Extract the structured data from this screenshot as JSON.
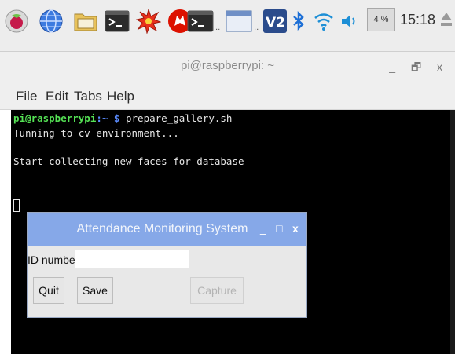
{
  "taskbar": {
    "icons": [
      "raspberry-menu-icon",
      "web-browser-icon",
      "file-manager-icon",
      "terminal-icon",
      "burst-icon",
      "wolfram-icon",
      "terminal-window-icon",
      "window-icon",
      "vnc-icon",
      "bluetooth-icon",
      "wifi-icon",
      "volume-icon"
    ],
    "cpu_usage": "4 %",
    "clock": "15:18"
  },
  "terminal_window": {
    "title": "pi@raspberrypi: ~",
    "controls": [
      "_",
      "🗗",
      "x"
    ],
    "menu": [
      "File",
      "Edit",
      "Tabs",
      "Help"
    ],
    "lines": {
      "prompt_user": "pi@raspberrypi",
      "prompt_path": ":~ $",
      "command": " prepare_gallery.sh",
      "line2": "Tunning to cv environment...",
      "line3": "Start collecting new faces for database"
    }
  },
  "dialog": {
    "title": "Attendance Monitoring System",
    "controls": [
      "_",
      "□",
      "x"
    ],
    "id_label": "ID number",
    "id_value": "",
    "buttons": {
      "quit": "Quit",
      "save": "Save",
      "capture": "Capture"
    }
  },
  "colors": {
    "dialog_title_bar": "#86a8e8",
    "prompt_user": "#55e255",
    "prompt_path": "#5b8cff"
  }
}
